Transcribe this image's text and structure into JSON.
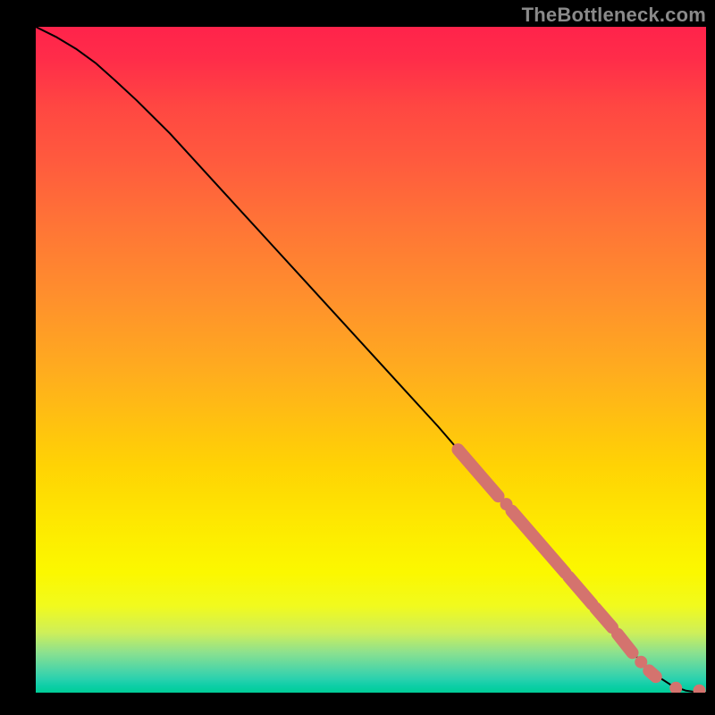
{
  "watermark": "TheBottleneck.com",
  "colors": {
    "marker": "#d4736e",
    "curve": "#000000",
    "background_top": "#ff234b",
    "background_bottom": "#00cd97"
  },
  "chart_data": {
    "type": "line",
    "title": "",
    "xlabel": "",
    "ylabel": "",
    "xlim": [
      0,
      100
    ],
    "ylim": [
      0,
      100
    ],
    "series": [
      {
        "name": "curve",
        "x": [
          0,
          3,
          6,
          9,
          12,
          15,
          20,
          25,
          30,
          35,
          40,
          45,
          50,
          55,
          60,
          63,
          66,
          70,
          73,
          76,
          79,
          82,
          85,
          87,
          89,
          90,
          91,
          93,
          95,
          97,
          99,
          100
        ],
        "y": [
          100,
          98.5,
          96.7,
          94.5,
          91.8,
          89,
          84,
          78.5,
          73,
          67.5,
          62,
          56.5,
          51,
          45.5,
          40,
          36.5,
          33,
          28.5,
          25,
          21.5,
          18,
          14.5,
          11,
          8.5,
          6,
          5,
          4,
          2.3,
          1,
          0.3,
          0,
          0
        ]
      }
    ],
    "markers": [
      {
        "type": "segment",
        "x0": 63,
        "y0": 36.5,
        "x1": 69,
        "y1": 29.5
      },
      {
        "type": "dot",
        "x": 70.2,
        "y": 28.3
      },
      {
        "type": "segment",
        "x0": 71,
        "y0": 27.3,
        "x1": 79,
        "y1": 18
      },
      {
        "type": "segment",
        "x0": 79.5,
        "y0": 17.4,
        "x1": 83,
        "y1": 13.3
      },
      {
        "type": "segment",
        "x0": 83.5,
        "y0": 12.7,
        "x1": 86,
        "y1": 9.8
      },
      {
        "type": "segment",
        "x0": 86.8,
        "y0": 8.8,
        "x1": 89,
        "y1": 6
      },
      {
        "type": "dot",
        "x": 90.3,
        "y": 4.6
      },
      {
        "type": "segment",
        "x0": 91.5,
        "y0": 3.3,
        "x1": 92.5,
        "y1": 2.4
      },
      {
        "type": "dot",
        "x": 95.5,
        "y": 0.7
      },
      {
        "type": "dot",
        "x": 99,
        "y": 0.3
      }
    ]
  }
}
